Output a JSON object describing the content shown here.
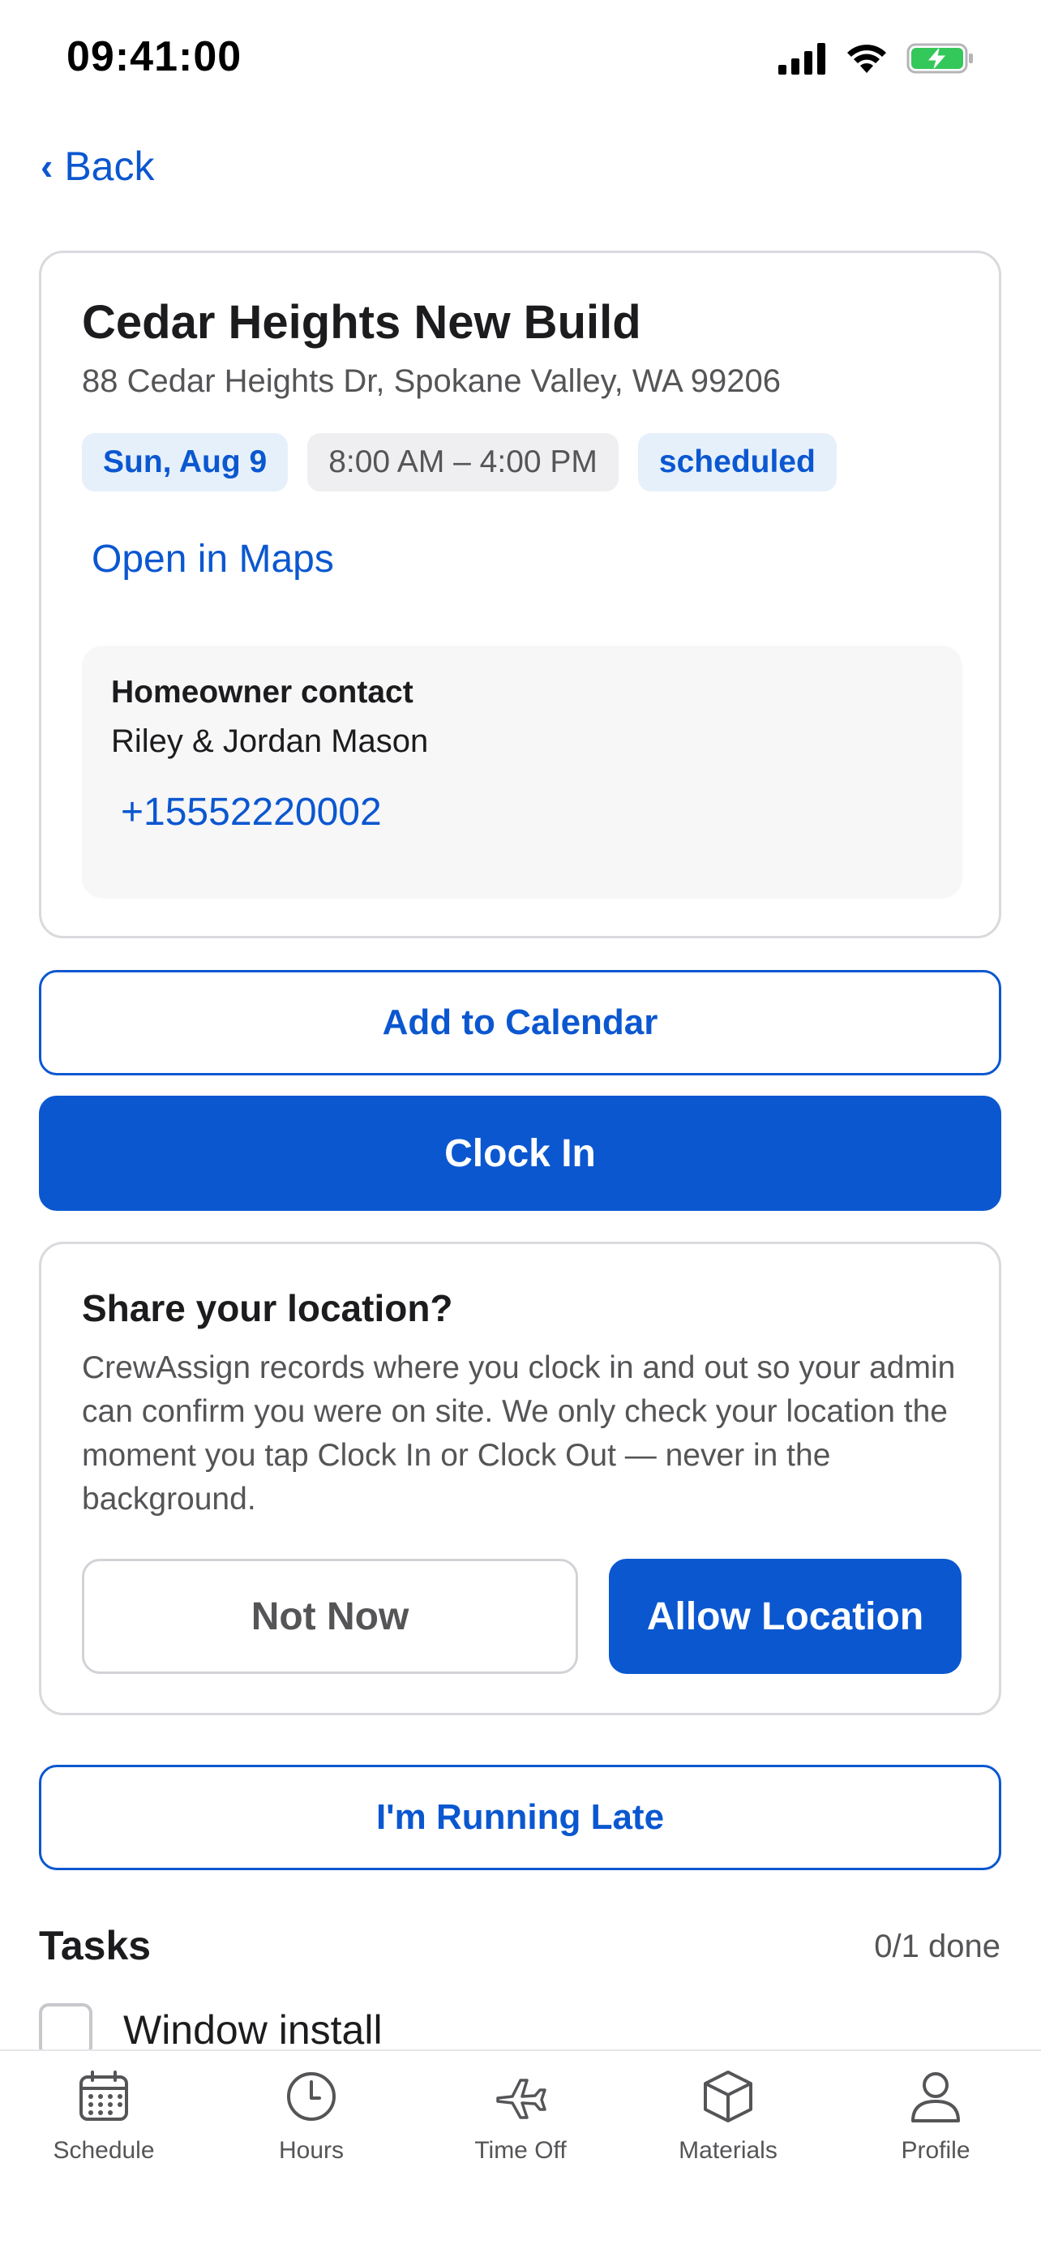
{
  "status_bar": {
    "time": "09:41:00"
  },
  "nav": {
    "back_label": "Back"
  },
  "job": {
    "title": "Cedar Heights New Build",
    "address": "88 Cedar Heights Dr, Spokane Valley, WA 99206",
    "date": "Sun, Aug 9",
    "time_range": "8:00 AM – 4:00 PM",
    "status": "scheduled",
    "maps_link": "Open in Maps",
    "contact": {
      "label": "Homeowner contact",
      "name": "Riley & Jordan Mason",
      "phone": "+15552220002"
    }
  },
  "actions": {
    "add_to_calendar": "Add to Calendar",
    "clock_in": "Clock In",
    "running_late": "I'm Running Late"
  },
  "location_prompt": {
    "title": "Share your location?",
    "body": "CrewAssign records where you clock in and out so your admin can confirm you were on site. We only check your location the moment you tap Clock In or Clock Out — never in the background.",
    "not_now": "Not Now",
    "allow": "Allow Location"
  },
  "tasks": {
    "title": "Tasks",
    "count": "0/1 done",
    "items": [
      {
        "label": "Window install",
        "checked": false
      }
    ]
  },
  "tab_bar": {
    "items": [
      {
        "label": "Schedule",
        "icon": "calendar-icon"
      },
      {
        "label": "Hours",
        "icon": "clock-icon"
      },
      {
        "label": "Time Off",
        "icon": "airplane-icon"
      },
      {
        "label": "Materials",
        "icon": "box-icon"
      },
      {
        "label": "Profile",
        "icon": "person-icon"
      }
    ]
  },
  "colors": {
    "accent": "#0b57d0",
    "chip_blue_bg": "#e6f0fb",
    "battery_green": "#34c759"
  }
}
